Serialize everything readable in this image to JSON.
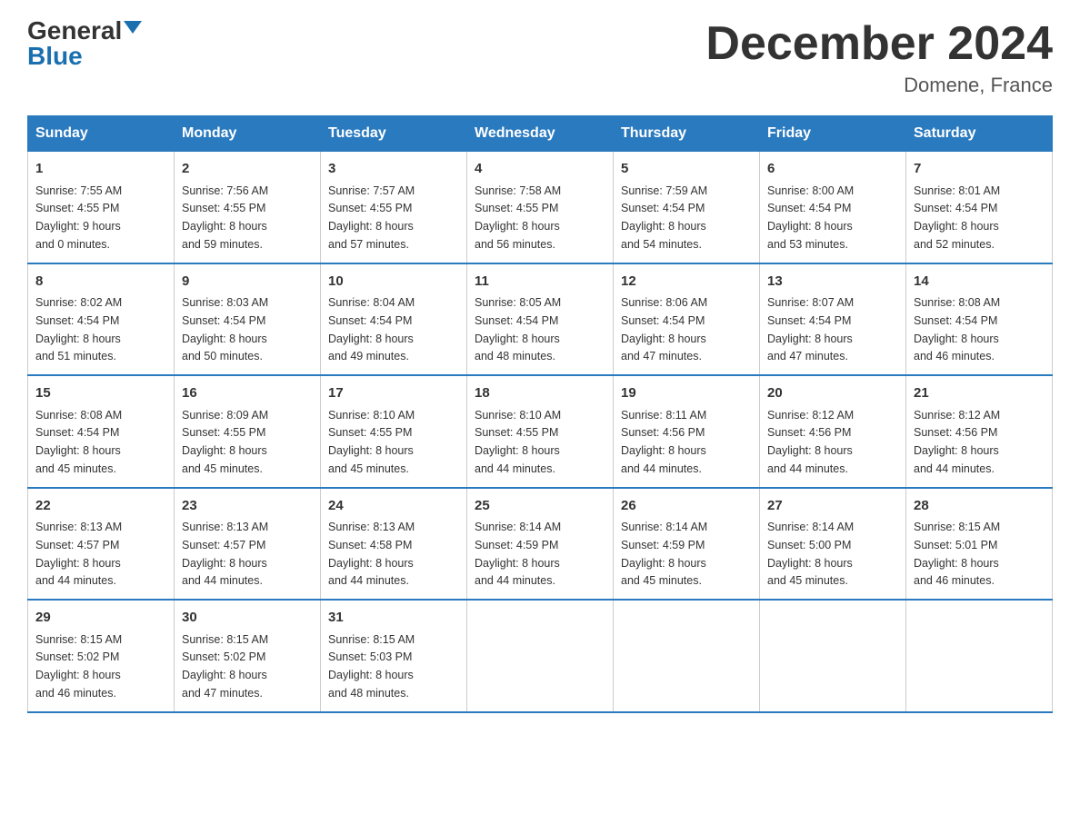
{
  "logo": {
    "general": "General",
    "blue": "Blue"
  },
  "title": "December 2024",
  "location": "Domene, France",
  "days_of_week": [
    "Sunday",
    "Monday",
    "Tuesday",
    "Wednesday",
    "Thursday",
    "Friday",
    "Saturday"
  ],
  "weeks": [
    [
      {
        "day": "1",
        "sunrise": "7:55 AM",
        "sunset": "4:55 PM",
        "daylight": "9 hours and 0 minutes."
      },
      {
        "day": "2",
        "sunrise": "7:56 AM",
        "sunset": "4:55 PM",
        "daylight": "8 hours and 59 minutes."
      },
      {
        "day": "3",
        "sunrise": "7:57 AM",
        "sunset": "4:55 PM",
        "daylight": "8 hours and 57 minutes."
      },
      {
        "day": "4",
        "sunrise": "7:58 AM",
        "sunset": "4:55 PM",
        "daylight": "8 hours and 56 minutes."
      },
      {
        "day": "5",
        "sunrise": "7:59 AM",
        "sunset": "4:54 PM",
        "daylight": "8 hours and 54 minutes."
      },
      {
        "day": "6",
        "sunrise": "8:00 AM",
        "sunset": "4:54 PM",
        "daylight": "8 hours and 53 minutes."
      },
      {
        "day": "7",
        "sunrise": "8:01 AM",
        "sunset": "4:54 PM",
        "daylight": "8 hours and 52 minutes."
      }
    ],
    [
      {
        "day": "8",
        "sunrise": "8:02 AM",
        "sunset": "4:54 PM",
        "daylight": "8 hours and 51 minutes."
      },
      {
        "day": "9",
        "sunrise": "8:03 AM",
        "sunset": "4:54 PM",
        "daylight": "8 hours and 50 minutes."
      },
      {
        "day": "10",
        "sunrise": "8:04 AM",
        "sunset": "4:54 PM",
        "daylight": "8 hours and 49 minutes."
      },
      {
        "day": "11",
        "sunrise": "8:05 AM",
        "sunset": "4:54 PM",
        "daylight": "8 hours and 48 minutes."
      },
      {
        "day": "12",
        "sunrise": "8:06 AM",
        "sunset": "4:54 PM",
        "daylight": "8 hours and 47 minutes."
      },
      {
        "day": "13",
        "sunrise": "8:07 AM",
        "sunset": "4:54 PM",
        "daylight": "8 hours and 47 minutes."
      },
      {
        "day": "14",
        "sunrise": "8:08 AM",
        "sunset": "4:54 PM",
        "daylight": "8 hours and 46 minutes."
      }
    ],
    [
      {
        "day": "15",
        "sunrise": "8:08 AM",
        "sunset": "4:54 PM",
        "daylight": "8 hours and 45 minutes."
      },
      {
        "day": "16",
        "sunrise": "8:09 AM",
        "sunset": "4:55 PM",
        "daylight": "8 hours and 45 minutes."
      },
      {
        "day": "17",
        "sunrise": "8:10 AM",
        "sunset": "4:55 PM",
        "daylight": "8 hours and 45 minutes."
      },
      {
        "day": "18",
        "sunrise": "8:10 AM",
        "sunset": "4:55 PM",
        "daylight": "8 hours and 44 minutes."
      },
      {
        "day": "19",
        "sunrise": "8:11 AM",
        "sunset": "4:56 PM",
        "daylight": "8 hours and 44 minutes."
      },
      {
        "day": "20",
        "sunrise": "8:12 AM",
        "sunset": "4:56 PM",
        "daylight": "8 hours and 44 minutes."
      },
      {
        "day": "21",
        "sunrise": "8:12 AM",
        "sunset": "4:56 PM",
        "daylight": "8 hours and 44 minutes."
      }
    ],
    [
      {
        "day": "22",
        "sunrise": "8:13 AM",
        "sunset": "4:57 PM",
        "daylight": "8 hours and 44 minutes."
      },
      {
        "day": "23",
        "sunrise": "8:13 AM",
        "sunset": "4:57 PM",
        "daylight": "8 hours and 44 minutes."
      },
      {
        "day": "24",
        "sunrise": "8:13 AM",
        "sunset": "4:58 PM",
        "daylight": "8 hours and 44 minutes."
      },
      {
        "day": "25",
        "sunrise": "8:14 AM",
        "sunset": "4:59 PM",
        "daylight": "8 hours and 44 minutes."
      },
      {
        "day": "26",
        "sunrise": "8:14 AM",
        "sunset": "4:59 PM",
        "daylight": "8 hours and 45 minutes."
      },
      {
        "day": "27",
        "sunrise": "8:14 AM",
        "sunset": "5:00 PM",
        "daylight": "8 hours and 45 minutes."
      },
      {
        "day": "28",
        "sunrise": "8:15 AM",
        "sunset": "5:01 PM",
        "daylight": "8 hours and 46 minutes."
      }
    ],
    [
      {
        "day": "29",
        "sunrise": "8:15 AM",
        "sunset": "5:02 PM",
        "daylight": "8 hours and 46 minutes."
      },
      {
        "day": "30",
        "sunrise": "8:15 AM",
        "sunset": "5:02 PM",
        "daylight": "8 hours and 47 minutes."
      },
      {
        "day": "31",
        "sunrise": "8:15 AM",
        "sunset": "5:03 PM",
        "daylight": "8 hours and 48 minutes."
      },
      null,
      null,
      null,
      null
    ]
  ]
}
